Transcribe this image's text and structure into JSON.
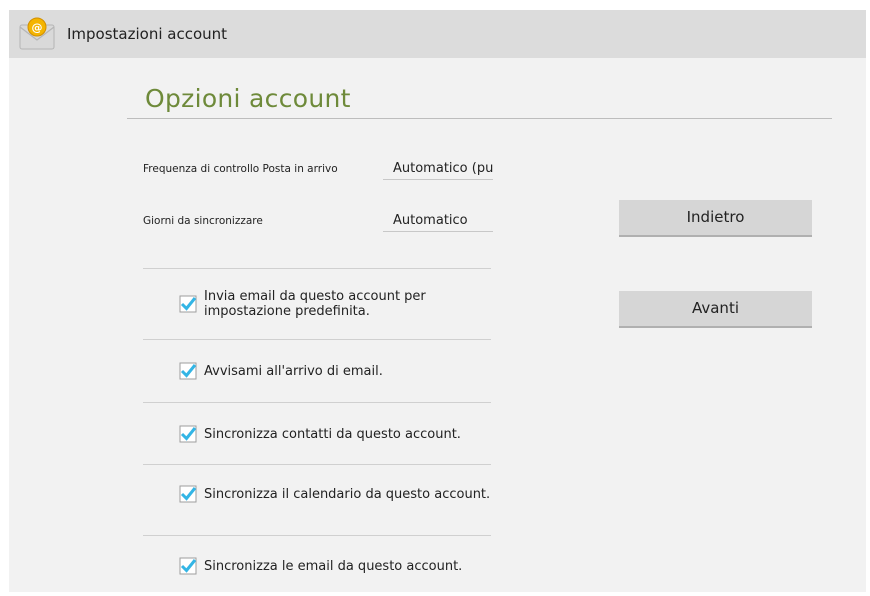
{
  "actionbar": {
    "title": "Impostazioni account",
    "icon": "email-app-icon"
  },
  "section": {
    "title": "Opzioni account"
  },
  "settings": {
    "check_frequency": {
      "label": "Frequenza di controllo Posta in arrivo",
      "value": "Automatico (pu"
    },
    "sync_days": {
      "label": "Giorni da sincronizzare",
      "value": "Automatico"
    }
  },
  "checkboxes": [
    {
      "label": "Invia email da questo account per impostazione predefinita.",
      "checked": true
    },
    {
      "label": "Avvisami all'arrivo di email.",
      "checked": true
    },
    {
      "label": "Sincronizza contatti da questo account.",
      "checked": true
    },
    {
      "label": "Sincronizza il calendario da questo account.",
      "checked": true
    },
    {
      "label": "Sincronizza le email da questo account.",
      "checked": true
    }
  ],
  "buttons": {
    "back": "Indietro",
    "next": "Avanti"
  },
  "colors": {
    "accent_title": "#6e8a3a",
    "checkbox": "#33b5e5",
    "actionbar": "#dcdcdc",
    "background": "#f2f2f2"
  }
}
